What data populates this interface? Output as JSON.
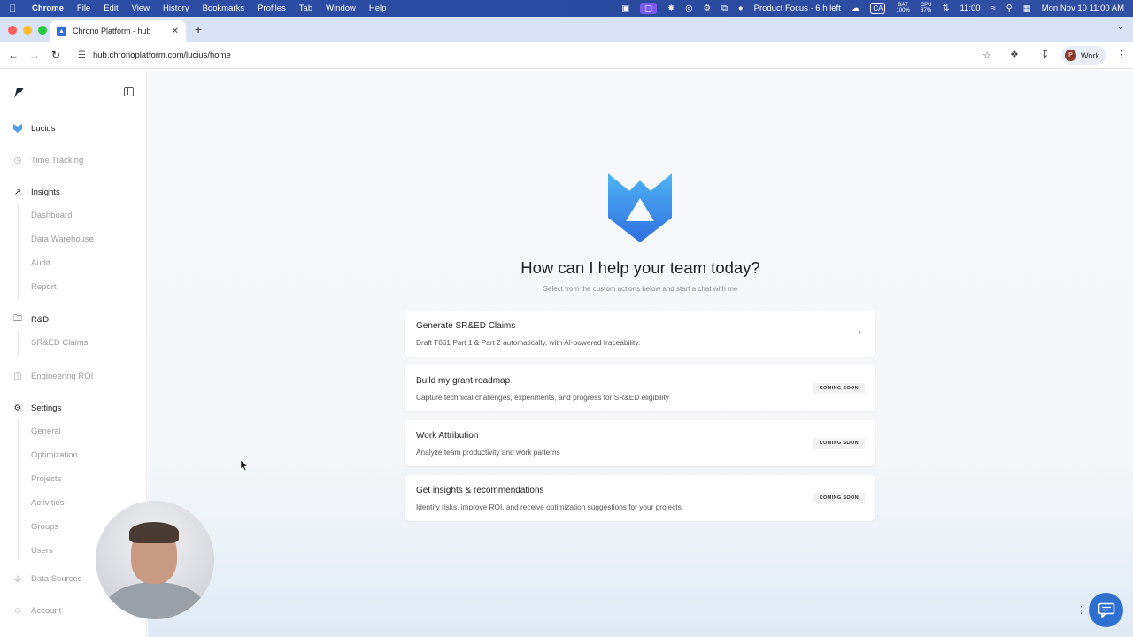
{
  "menubar": {
    "app": "Chrome",
    "items": [
      "File",
      "Edit",
      "View",
      "History",
      "Bookmarks",
      "Profiles",
      "Tab",
      "Window",
      "Help"
    ],
    "focus": "Product Focus · 6 h left",
    "ca": "CA",
    "bat_label": "BAT",
    "bat_value": "100%",
    "cpu_label": "CPU",
    "cpu_value": "37%",
    "clock_short": "11:00",
    "datetime": "Mon Nov 10  11:00 AM"
  },
  "browser": {
    "tab_title": "Chrono Platform - hub",
    "url": "hub.chronoplatform.com/lucius/home",
    "profile_initial": "P",
    "profile_label": "Work"
  },
  "sidebar": {
    "lucius": "Lucius",
    "time_tracking": "Time Tracking",
    "insights": "Insights",
    "insights_sub": [
      "Dashboard",
      "Data Warehouse",
      "Audit",
      "Report"
    ],
    "rd": "R&D",
    "rd_sub": [
      "SR&ED Claims"
    ],
    "engineering_roi": "Engineering ROI",
    "settings": "Settings",
    "settings_sub": [
      "General",
      "Optimization",
      "Projects",
      "Activities",
      "Groups",
      "Users"
    ],
    "data_sources": "Data Sources",
    "account": "Account"
  },
  "main": {
    "headline": "How can I help your team today?",
    "subline": "Select from the custom actions below and start a chat with me",
    "cards": [
      {
        "title": "Generate SR&ED Claims",
        "desc": "Draft T661 Part 1 & Part 2 automatically, with AI-powered traceability.",
        "badge": ""
      },
      {
        "title": "Build my grant roadmap",
        "desc": "Capture technical challenges, experiments, and progress for SR&ED eligibility",
        "badge": "COMING SOON"
      },
      {
        "title": "Work Attribution",
        "desc": "Analyze team productivity and work patterns",
        "badge": "COMING SOON"
      },
      {
        "title": "Get insights & recommendations",
        "desc": "Identify risks, improve ROI, and receive optimization suggestions for your projects.",
        "badge": "COMING SOON"
      }
    ]
  },
  "colors": {
    "accent": "#2f6fd0",
    "menubar": "#2d4ea6",
    "logo_light": "#5ab8f5",
    "logo_dark": "#2f6fe0"
  }
}
